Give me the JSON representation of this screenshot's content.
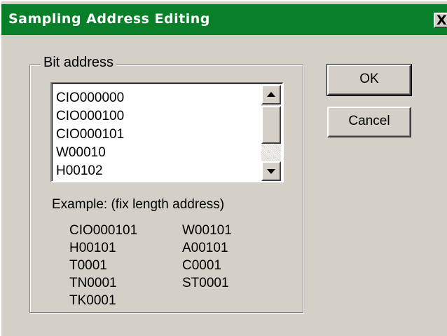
{
  "window": {
    "title": "Sampling Address Editing",
    "close_label": "X"
  },
  "group": {
    "label": "Bit address"
  },
  "listbox": {
    "items": [
      "CIO000000",
      "CIO000100",
      "CIO000101",
      "W00010",
      "H00102"
    ]
  },
  "example": {
    "heading": "Example: (fix length address)",
    "left_column": [
      "CIO000101",
      "H00101",
      "T0001",
      "TN0001",
      "TK0001"
    ],
    "right_column": [
      "W00101",
      "A00101",
      "C0001",
      "ST0001"
    ]
  },
  "buttons": {
    "ok_label": "OK",
    "cancel_label": "Cancel"
  },
  "icons": {
    "close": "close-icon",
    "scroll_up": "scroll-up-arrow-icon",
    "scroll_down": "scroll-down-arrow-icon"
  },
  "colors": {
    "titlebar": "#0a7f2a",
    "dialog_face": "#d4d0c8"
  }
}
